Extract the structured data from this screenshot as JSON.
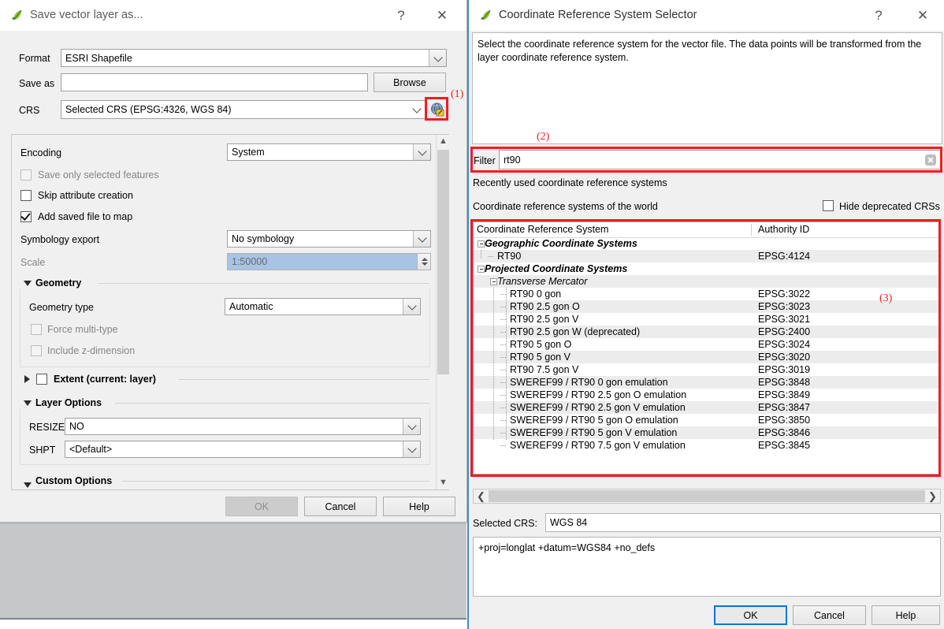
{
  "save_dialog": {
    "title": "Save vector layer as...",
    "help_glyph": "?",
    "close_glyph": "✕",
    "format_label": "Format",
    "format_value": "ESRI Shapefile",
    "saveas_label": "Save as",
    "saveas_value": "",
    "browse_label": "Browse",
    "crs_label": "CRS",
    "crs_value": "Selected CRS (EPSG:4326, WGS 84)",
    "crs_picker_icon": "globe-edit-icon",
    "options": {
      "encoding_label": "Encoding",
      "encoding_value": "System",
      "save_selected_label": "Save only selected features",
      "save_selected_checked": false,
      "skip_attribute_label": "Skip attribute creation",
      "skip_attribute_checked": false,
      "add_saved_label": "Add saved file to map",
      "add_saved_checked": true,
      "symbology_label": "Symbology export",
      "symbology_value": "No symbology",
      "scale_label": "Scale",
      "scale_value": "1:50000",
      "geometry_group": "Geometry",
      "geometry_type_label": "Geometry type",
      "geometry_type_value": "Automatic",
      "force_multi_label": "Force multi-type",
      "force_multi_checked": false,
      "include_z_label": "Include z-dimension",
      "include_z_checked": false,
      "extent_label": "Extent (current: layer)",
      "extent_checked": false,
      "layer_options_group": "Layer Options",
      "resize_label": "RESIZE",
      "resize_value": "NO",
      "shpt_label": "SHPT",
      "shpt_value": "<Default>",
      "custom_options_group": "Custom Options"
    },
    "buttons": {
      "ok": "OK",
      "cancel": "Cancel",
      "help": "Help"
    }
  },
  "crs_dialog": {
    "title": "Coordinate Reference System Selector",
    "help_glyph": "?",
    "close_glyph": "✕",
    "description": "Select the coordinate reference system for the vector file. The data points will be transformed from the layer coordinate reference system.",
    "filter_label": "Filter",
    "filter_value": "rt90",
    "filter_clear_icon": "clear-icon",
    "recent_label": "Recently used coordinate reference systems",
    "world_label": "Coordinate reference systems of the world",
    "hide_deprecated_label": "Hide deprecated CRSs",
    "hide_deprecated_checked": false,
    "columns": [
      "Coordinate Reference System",
      "Authority ID"
    ],
    "rows": [
      {
        "name": "Geographic Coordinate Systems",
        "authority": "",
        "indent": 0,
        "style": "bold-italic",
        "expander": true
      },
      {
        "name": "RT90",
        "authority": "EPSG:4124",
        "indent": 1,
        "style": "normal",
        "expander": false
      },
      {
        "name": "Projected Coordinate Systems",
        "authority": "",
        "indent": 0,
        "style": "bold-italic",
        "expander": true
      },
      {
        "name": "Transverse Mercator",
        "authority": "",
        "indent": 1,
        "style": "italic",
        "expander": true
      },
      {
        "name": "RT90 0 gon",
        "authority": "EPSG:3022",
        "indent": 2,
        "style": "normal",
        "expander": false
      },
      {
        "name": "RT90 2.5 gon O",
        "authority": "EPSG:3023",
        "indent": 2,
        "style": "normal",
        "expander": false
      },
      {
        "name": "RT90 2.5 gon V",
        "authority": "EPSG:3021",
        "indent": 2,
        "style": "normal",
        "expander": false
      },
      {
        "name": "RT90 2.5 gon W (deprecated)",
        "authority": "EPSG:2400",
        "indent": 2,
        "style": "normal",
        "expander": false
      },
      {
        "name": "RT90 5 gon O",
        "authority": "EPSG:3024",
        "indent": 2,
        "style": "normal",
        "expander": false
      },
      {
        "name": "RT90 5 gon V",
        "authority": "EPSG:3020",
        "indent": 2,
        "style": "normal",
        "expander": false
      },
      {
        "name": "RT90 7.5 gon V",
        "authority": "EPSG:3019",
        "indent": 2,
        "style": "normal",
        "expander": false
      },
      {
        "name": "SWEREF99 / RT90 0 gon emulation",
        "authority": "EPSG:3848",
        "indent": 2,
        "style": "normal",
        "expander": false
      },
      {
        "name": "SWEREF99 / RT90 2.5 gon O emulation",
        "authority": "EPSG:3849",
        "indent": 2,
        "style": "normal",
        "expander": false
      },
      {
        "name": "SWEREF99 / RT90 2.5 gon V emulation",
        "authority": "EPSG:3847",
        "indent": 2,
        "style": "normal",
        "expander": false
      },
      {
        "name": "SWEREF99 / RT90 5 gon O emulation",
        "authority": "EPSG:3850",
        "indent": 2,
        "style": "normal",
        "expander": false
      },
      {
        "name": "SWEREF99 / RT90 5 gon V emulation",
        "authority": "EPSG:3846",
        "indent": 2,
        "style": "normal",
        "expander": false
      },
      {
        "name": "SWEREF99 / RT90 7.5 gon V emulation",
        "authority": "EPSG:3845",
        "indent": 2,
        "style": "normal",
        "expander": false
      }
    ],
    "selected_crs_label": "Selected CRS:",
    "selected_crs_value": "WGS 84",
    "proj_string": "+proj=longlat +datum=WGS84 +no_defs",
    "buttons": {
      "ok": "OK",
      "cancel": "Cancel",
      "help": "Help"
    }
  },
  "annotations": {
    "accent_color": "#f41c1c",
    "one": "(1)",
    "two": "(2)",
    "three": "(3)"
  }
}
